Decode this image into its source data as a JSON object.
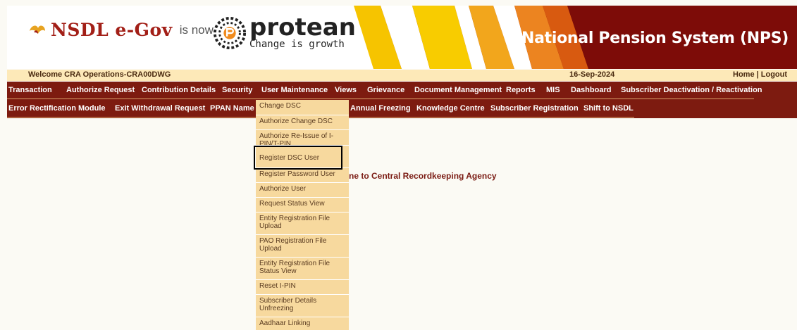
{
  "header": {
    "nsdl_logo_text": "NSDL e-Gov",
    "is_now": "is now",
    "protean_name": "protean",
    "protean_tagline": "Change is growth",
    "title": "National Pension System (NPS)",
    "colors": {
      "dark_red": "#7d0c08",
      "gold": "#f5b800",
      "orange": "#e8711a"
    }
  },
  "welcome_bar": {
    "welcome_text": "Welcome CRA Operations-CRA00DWG",
    "date": "16-Sep-2024",
    "links": "Home | Logout"
  },
  "menu_row1": [
    "Transaction",
    "Authorize Request",
    "Contribution Details",
    "Security",
    "User Maintenance",
    "Views",
    "Grievance",
    "Document Management",
    "Reports",
    "MIS",
    "Dashboard",
    "Subscriber Deactivation / Reactivation"
  ],
  "menu_row2": [
    "Error Rectification Module",
    "Exit Withdrawal Request",
    "PPAN Name F",
    "Annual Freezing",
    "Knowledge Centre",
    "Subscriber Registration",
    "Shift to NSDL"
  ],
  "dropdown_items": [
    "Change DSC",
    "Authorize Change DSC",
    "Authorize Re-Issue of I-PIN/T-PIN",
    "Register DSC User",
    "Register Password User",
    "Authorize User",
    "Request Status View",
    "Entity Registration File Upload",
    "PAO Registration File Upload",
    "Entity Registration File Status View",
    "Reset I-PIN",
    "Subscriber Details Unfreezing",
    "Aadhaar Linking"
  ],
  "welcome_message": "ne to Central Recordkeeping Agency"
}
